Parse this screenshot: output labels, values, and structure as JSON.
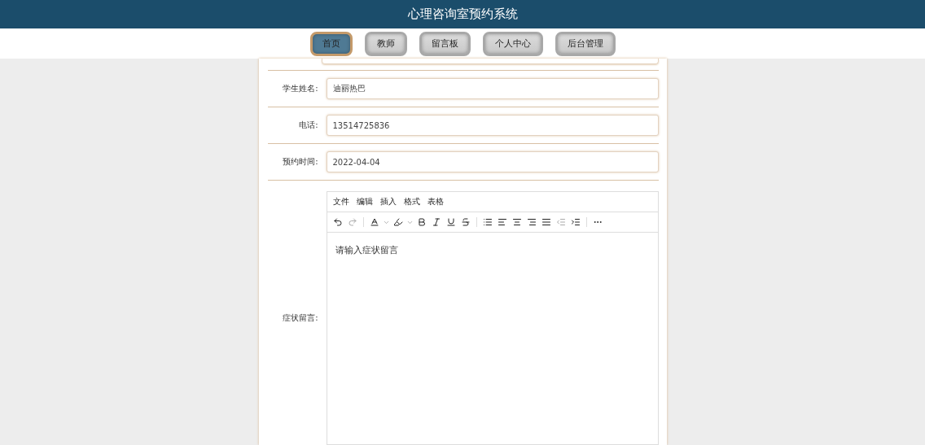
{
  "header": {
    "title": "心理咨询室预约系统"
  },
  "nav": [
    {
      "label": "首页",
      "selected": true
    },
    {
      "label": "教师",
      "selected": false
    },
    {
      "label": "留言板",
      "selected": false
    },
    {
      "label": "个人中心",
      "selected": false
    },
    {
      "label": "后台管理",
      "selected": false
    }
  ],
  "fields": [
    {
      "label": "学生姓名:",
      "value": "迪丽热巴"
    },
    {
      "label": "电话:",
      "value": "13514725836"
    },
    {
      "label": "预约时间:",
      "value": "2022-04-04"
    }
  ],
  "editor": {
    "label": "症状留言:",
    "menus": [
      "文件",
      "编辑",
      "插入",
      "格式",
      "表格"
    ],
    "toolbar": [
      [
        {
          "kind": "undo",
          "disabled": false
        },
        {
          "kind": "redo",
          "disabled": true
        }
      ],
      [
        {
          "kind": "text-color",
          "disabled": false
        },
        {
          "kind": "highlight",
          "disabled": false
        },
        {
          "kind": "bold",
          "disabled": false
        },
        {
          "kind": "italic",
          "disabled": false
        },
        {
          "kind": "underline",
          "disabled": false
        },
        {
          "kind": "strike",
          "disabled": false
        }
      ],
      [
        {
          "kind": "list",
          "disabled": false
        },
        {
          "kind": "align-left",
          "disabled": false
        },
        {
          "kind": "align-center",
          "disabled": false
        },
        {
          "kind": "align-right",
          "disabled": false
        },
        {
          "kind": "justify",
          "disabled": false
        },
        {
          "kind": "outdent",
          "disabled": true
        },
        {
          "kind": "indent",
          "disabled": false
        }
      ],
      [
        {
          "kind": "more",
          "disabled": false
        }
      ]
    ],
    "placeholder": "请输入症状留言"
  }
}
